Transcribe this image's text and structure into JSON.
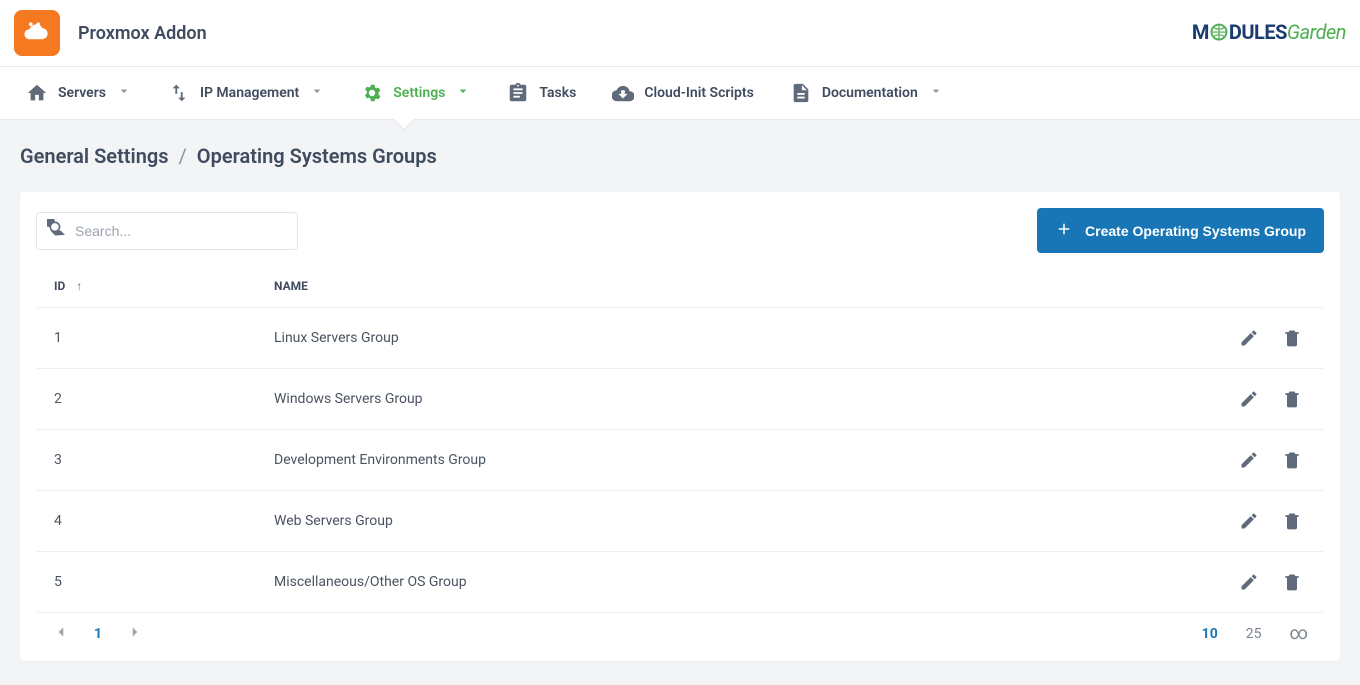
{
  "header": {
    "app_title": "Proxmox Addon",
    "brand_prefix": "M",
    "brand_mid": "DULES",
    "brand_suffix": "Garden"
  },
  "nav": {
    "servers": "Servers",
    "ip_management": "IP Management",
    "settings": "Settings",
    "tasks": "Tasks",
    "cloud_init": "Cloud-Init Scripts",
    "documentation": "Documentation"
  },
  "breadcrumb": {
    "parent": "General Settings",
    "current": "Operating Systems Groups"
  },
  "toolbar": {
    "search_placeholder": "Search...",
    "create_button": "Create Operating Systems Group"
  },
  "table": {
    "columns": {
      "id": "ID",
      "name": "NAME"
    },
    "rows": [
      {
        "id": "1",
        "name": "Linux Servers Group"
      },
      {
        "id": "2",
        "name": "Windows Servers Group"
      },
      {
        "id": "3",
        "name": "Development Environments Group"
      },
      {
        "id": "4",
        "name": "Web Servers Group"
      },
      {
        "id": "5",
        "name": "Miscellaneous/Other OS Group"
      }
    ]
  },
  "pagination": {
    "current_page": "1",
    "sizes": [
      "10",
      "25",
      "∞"
    ],
    "active_size_index": 0
  }
}
